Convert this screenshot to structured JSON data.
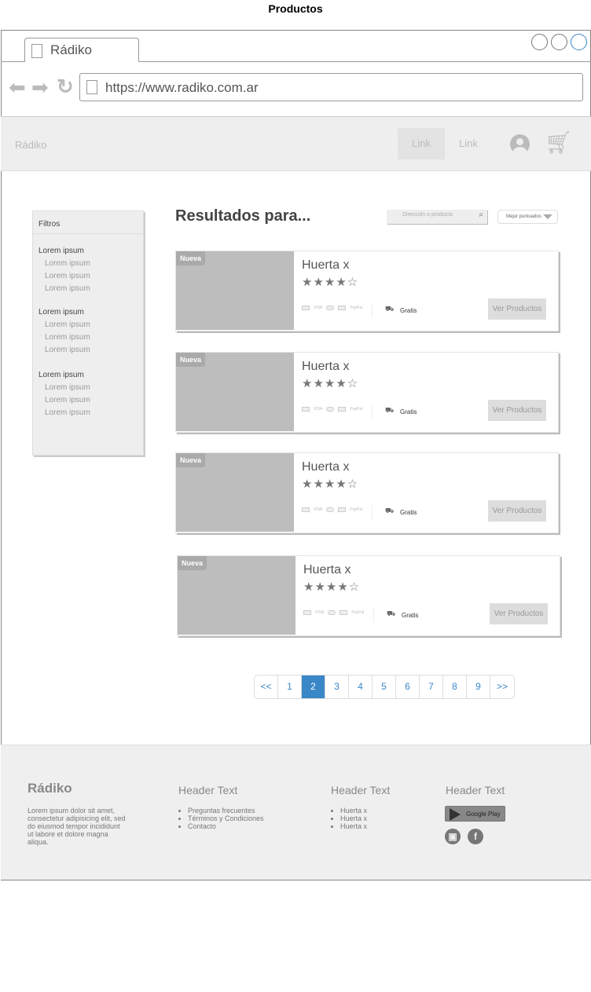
{
  "page_title": "Productos",
  "browser": {
    "tab_title": "Rádiko",
    "url": "https://www.radiko.com.ar"
  },
  "nav": {
    "brand": "Rádiko",
    "links": [
      "Link",
      "Link"
    ]
  },
  "sidebar": {
    "title": "Filtros",
    "groups": [
      {
        "label": "Lorem ipsum",
        "items": [
          "Lorem ipsum",
          "Lorem ipsum",
          "Lorem ipsum"
        ]
      },
      {
        "label": "Lorem ipsum",
        "items": [
          "Lorem ipsum",
          "Lorem ipsum",
          "Lorem ipsum"
        ]
      },
      {
        "label": "Lorem ipsum",
        "items": [
          "Lorem ipsum",
          "Lorem ipsum",
          "Lorem ipsum"
        ]
      }
    ]
  },
  "results": {
    "heading": "Resultados para...",
    "search_placeholder": "Dirección o producto",
    "sort_value": "Mejor puntuados"
  },
  "cards": [
    {
      "badge": "Nueva",
      "name": "Huerta x",
      "rating": 4,
      "stars": "★★★★☆",
      "payments": [
        "VISA",
        "PayPal"
      ],
      "shipping": "Gratis",
      "button": "Ver Productos"
    },
    {
      "badge": "Nueva",
      "name": "Huerta x",
      "rating": 4,
      "stars": "★★★★☆",
      "payments": [
        "VISA",
        "PayPal"
      ],
      "shipping": "Gratis",
      "button": "Ver Productos"
    },
    {
      "badge": "Nueva",
      "name": "Huerta x",
      "rating": 4,
      "stars": "★★★★☆",
      "payments": [
        "VISA",
        "PayPal"
      ],
      "shipping": "Gratis",
      "button": "Ver Productos"
    },
    {
      "badge": "Nueva",
      "name": "Huerta x",
      "rating": 4,
      "stars": "★★★★☆",
      "payments": [
        "VISA",
        "PayPal"
      ],
      "shipping": "Gratis",
      "button": "Ver Productos"
    }
  ],
  "pagination": {
    "items": [
      "<<",
      "1",
      "2",
      "3",
      "4",
      "5",
      "6",
      "7",
      "8",
      "9",
      ">>"
    ],
    "active": "2",
    "accent": "#3a87c8"
  },
  "footer": {
    "brand": "Rádiko",
    "about": "Lorem ipsum dolor sit amet, consectetur adipisicing elit, sed do eiusmod tempor incididunt ut labore et dolore magna aliqua.",
    "col1": {
      "header": "Header Text",
      "items": [
        "Preguntas frecuentes",
        "Términos y Condiciones",
        "Contacto"
      ]
    },
    "col2": {
      "header": "Header Text",
      "items": [
        "Huerta x",
        "Huerta x",
        "Huerta x"
      ]
    },
    "col3": {
      "header": "Header Text",
      "store_button": "Google Play",
      "social": [
        "instagram",
        "facebook"
      ]
    }
  }
}
